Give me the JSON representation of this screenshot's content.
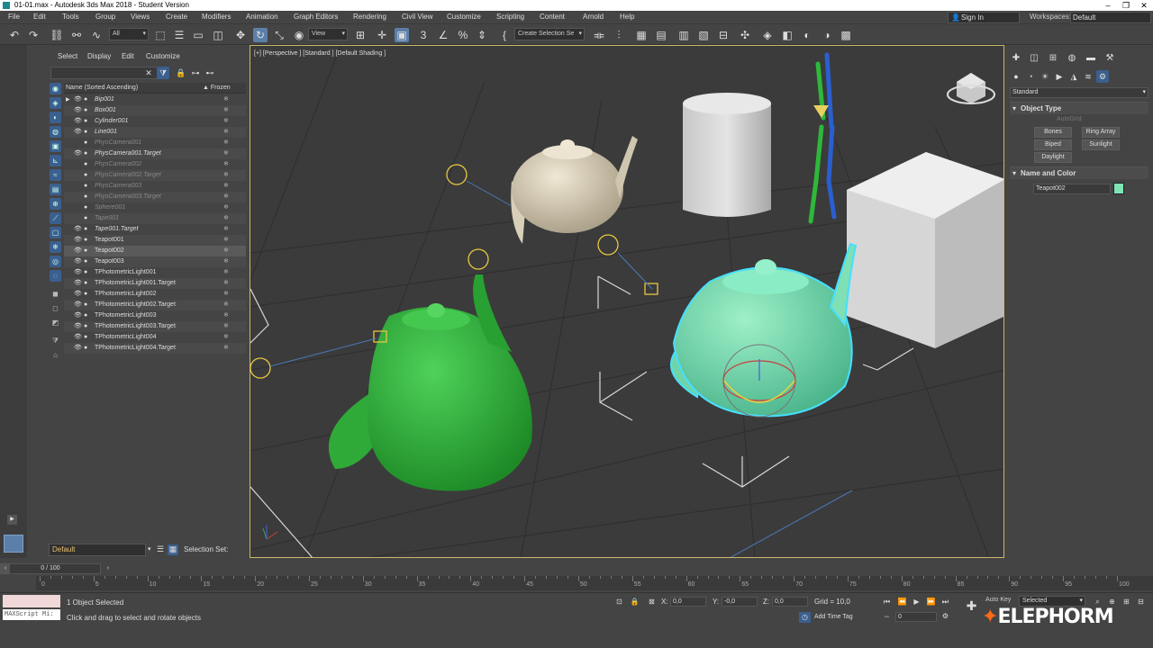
{
  "window": {
    "title": "01-01.max - Autodesk 3ds Max 2018 - Student Version"
  },
  "menus": [
    "File",
    "Edit",
    "Tools",
    "Group",
    "Views",
    "Create",
    "Modifiers",
    "Animation",
    "Graph Editors",
    "Rendering",
    "Civil View",
    "Customize",
    "Scripting",
    "Content",
    "Arnold",
    "Help"
  ],
  "header": {
    "signin": "Sign In",
    "workspaces_label": "Workspaces:",
    "workspace": "Default"
  },
  "toolbar": {
    "filter": "All",
    "view": "View",
    "selection_set": "Create Selection Se"
  },
  "scene_explorer": {
    "menus": [
      "Select",
      "Display",
      "Edit",
      "Customize"
    ],
    "col_name": "Name (Sorted Ascending)",
    "col_frozen": "▲ Frozen",
    "rows": [
      {
        "name": "Bip001",
        "style": "ital",
        "tri": "▶"
      },
      {
        "name": "Box001",
        "style": "ital",
        "tri": ""
      },
      {
        "name": "Cylinder001",
        "style": "ital",
        "tri": ""
      },
      {
        "name": "Line001",
        "style": "ital",
        "tri": ""
      },
      {
        "name": "PhysCamera001",
        "style": "grey",
        "tri": ""
      },
      {
        "name": "PhysCamera001.Target",
        "style": "ital",
        "tri": ""
      },
      {
        "name": "PhysCamera002",
        "style": "grey",
        "tri": ""
      },
      {
        "name": "PhysCamera002.Target",
        "style": "grey",
        "tri": ""
      },
      {
        "name": "PhysCamera003",
        "style": "grey",
        "tri": ""
      },
      {
        "name": "PhysCamera003.Target",
        "style": "grey",
        "tri": ""
      },
      {
        "name": "Sphere001",
        "style": "grey",
        "tri": ""
      },
      {
        "name": "Tape001",
        "style": "grey",
        "tri": ""
      },
      {
        "name": "Tape001.Target",
        "style": "ital",
        "tri": ""
      },
      {
        "name": "Teapot001",
        "style": "",
        "tri": ""
      },
      {
        "name": "Teapot002",
        "style": "sel",
        "tri": ""
      },
      {
        "name": "Teapot003",
        "style": "",
        "tri": ""
      },
      {
        "name": "TPhotometricLight001",
        "style": "",
        "tri": ""
      },
      {
        "name": "TPhotometricLight001.Target",
        "style": "",
        "tri": ""
      },
      {
        "name": "TPhotometricLight002",
        "style": "",
        "tri": ""
      },
      {
        "name": "TPhotometricLight002.Target",
        "style": "",
        "tri": ""
      },
      {
        "name": "TPhotometricLight003",
        "style": "",
        "tri": ""
      },
      {
        "name": "TPhotometricLight003.Target",
        "style": "",
        "tri": ""
      },
      {
        "name": "TPhotometricLight004",
        "style": "",
        "tri": ""
      },
      {
        "name": "TPhotometricLight004.Target",
        "style": "",
        "tri": ""
      }
    ],
    "layer": "Default",
    "selection_set": "Selection Set:"
  },
  "viewport": {
    "label": "[+] [Perspective ] [Standard ] [Default Shading ]"
  },
  "command_panel": {
    "category": "Standard",
    "rollout_object_type": "Object Type",
    "autogrid": "AutoGrid",
    "buttons": [
      "Bones",
      "Ring Array",
      "Biped",
      "Sunlight",
      "Daylight"
    ],
    "rollout_name_color": "Name and Color",
    "object_name": "Teapot002",
    "object_color": "#7fe3b4"
  },
  "timeline": {
    "slider": "0 / 100",
    "ticks": [
      "0",
      "5",
      "10",
      "15",
      "20",
      "25",
      "30",
      "35",
      "40",
      "45",
      "50",
      "55",
      "60",
      "65",
      "70",
      "75",
      "80",
      "85",
      "90",
      "95",
      "100"
    ]
  },
  "status": {
    "selected": "1 Object Selected",
    "hint": "Click and drag to select and rotate objects",
    "x_label": "X:",
    "x": "0,0",
    "y_label": "Y:",
    "y": "-0,0",
    "z_label": "Z:",
    "z": "0,0",
    "grid": "Grid = 10,0",
    "add_time_tag": "Add Time Tag",
    "auto_key": "Auto Key",
    "key_filter": "Selected",
    "frame": "0",
    "maxscript": "MAXScript Mi:"
  },
  "watermark": {
    "prefix": "ELEP",
    "accent": "",
    "text": "ELEPHORM"
  }
}
